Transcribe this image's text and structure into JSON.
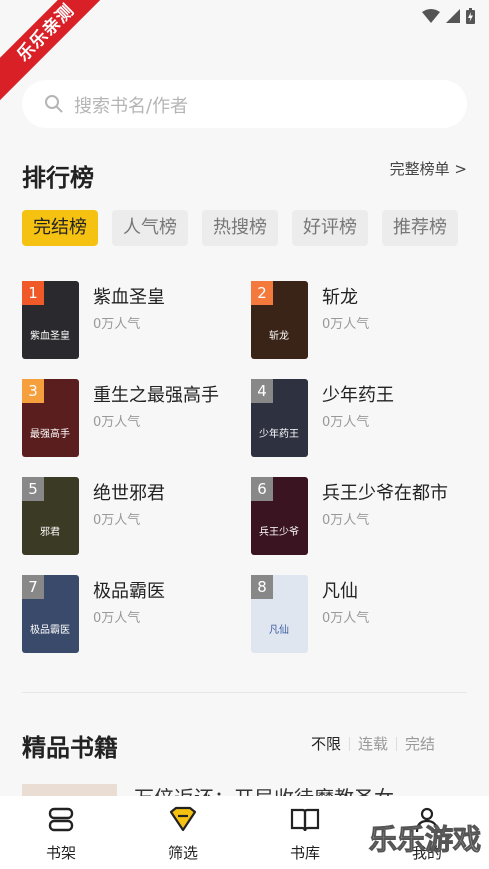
{
  "badge": "乐乐亲测",
  "search": {
    "placeholder": "搜索书名/作者"
  },
  "ranking": {
    "title": "排行榜",
    "more": "完整榜单 >",
    "tabs": [
      {
        "label": "完结榜",
        "active": true
      },
      {
        "label": "人气榜"
      },
      {
        "label": "热搜榜"
      },
      {
        "label": "好评榜"
      },
      {
        "label": "推荐榜"
      }
    ],
    "books": [
      {
        "rank": "1",
        "title": "紫血圣皇",
        "sub": "0万人气",
        "cover_text": "紫血圣皇",
        "rank_color": "#f05a28",
        "cover_color": "#2a2a2e"
      },
      {
        "rank": "2",
        "title": "斩龙",
        "sub": "0万人气",
        "cover_text": "斩龙",
        "rank_color": "#f37a3c",
        "cover_color": "#3a2418"
      },
      {
        "rank": "3",
        "title": "重生之最强高手",
        "sub": "0万人气",
        "cover_text": "最强高手",
        "rank_color": "#f6a03d",
        "cover_color": "#5a1e1e"
      },
      {
        "rank": "4",
        "title": "少年药王",
        "sub": "0万人气",
        "cover_text": "少年药王",
        "rank_color": "#888888",
        "cover_color": "#2d3140"
      },
      {
        "rank": "5",
        "title": "绝世邪君",
        "sub": "0万人气",
        "cover_text": "邪君",
        "rank_color": "#888888",
        "cover_color": "#3b3a24"
      },
      {
        "rank": "6",
        "title": "兵王少爷在都市",
        "sub": "0万人气",
        "cover_text": "兵王少爷",
        "rank_color": "#888888",
        "cover_color": "#3a1420"
      },
      {
        "rank": "7",
        "title": "极品霸医",
        "sub": "0万人气",
        "cover_text": "极品霸医",
        "rank_color": "#888888",
        "cover_color": "#3a4a6a"
      },
      {
        "rank": "8",
        "title": "凡仙",
        "sub": "0万人气",
        "cover_text": "凡仙",
        "rank_color": "#888888",
        "cover_color": "#dfe6f0"
      }
    ]
  },
  "premium": {
    "title": "精品书籍",
    "filters": [
      {
        "label": "不限",
        "active": true
      },
      {
        "label": "连载"
      },
      {
        "label": "完结"
      }
    ],
    "peek_title": "万倍返还：开局收徒魔教圣女"
  },
  "nav": [
    {
      "label": "书架",
      "icon": "bookshelf-icon"
    },
    {
      "label": "筛选",
      "icon": "filter-icon"
    },
    {
      "label": "书库",
      "icon": "library-icon"
    },
    {
      "label": "我的",
      "icon": "profile-icon"
    }
  ],
  "watermark": "乐乐游戏",
  "colors": {
    "accent": "#f6c211",
    "badge": "#d92027"
  }
}
